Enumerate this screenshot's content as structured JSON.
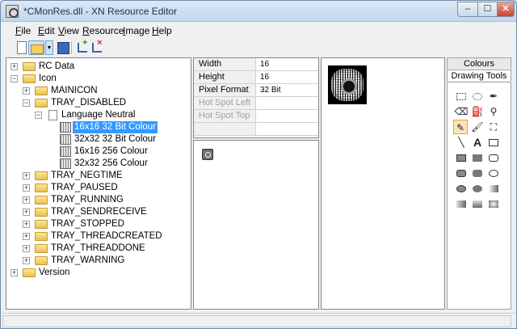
{
  "window": {
    "title": "*CMonRes.dll - XN Resource Editor",
    "minimize": "‒",
    "maximize": "☐",
    "close": "✕"
  },
  "menu": [
    "File",
    "Edit",
    "View",
    "Resource",
    "Image",
    "Help"
  ],
  "toolbar": {
    "buttons": [
      "new-icon",
      "open-icon",
      "save-icon",
      "add-resource-icon",
      "delete-resource-icon"
    ]
  },
  "tree": {
    "items": [
      {
        "label": "RC Data",
        "expander": "+"
      },
      {
        "label": "Icon",
        "expander": "−"
      },
      {
        "label": "MAINICON",
        "expander": "+"
      },
      {
        "label": "TRAY_DISABLED",
        "expander": "−"
      },
      {
        "label": "Language Neutral",
        "expander": "−"
      },
      {
        "label": "16x16 32 Bit Colour"
      },
      {
        "label": "32x32 32 Bit Colour"
      },
      {
        "label": "16x16 256 Colour"
      },
      {
        "label": "32x32 256 Colour"
      },
      {
        "label": "TRAY_NEGTIME",
        "expander": "+"
      },
      {
        "label": "TRAY_PAUSED",
        "expander": "+"
      },
      {
        "label": "TRAY_RUNNING",
        "expander": "+"
      },
      {
        "label": "TRAY_SENDRECEIVE",
        "expander": "+"
      },
      {
        "label": "TRAY_STOPPED",
        "expander": "+"
      },
      {
        "label": "TRAY_THREADCREATED",
        "expander": "+"
      },
      {
        "label": "TRAY_THREADDONE",
        "expander": "+"
      },
      {
        "label": "TRAY_WARNING",
        "expander": "+"
      },
      {
        "label": "Version",
        "expander": "+"
      }
    ]
  },
  "properties": [
    {
      "name": "Width",
      "value": "16"
    },
    {
      "name": "Height",
      "value": "16"
    },
    {
      "name": "Pixel Format",
      "value": "32 Bit"
    },
    {
      "name": "Hot Spot Left",
      "value": ""
    },
    {
      "name": "Hot Spot Top",
      "value": ""
    }
  ],
  "tools_panel": {
    "tab_colours": "Colours",
    "tab_drawing_tools": "Drawing Tools",
    "text_tool_glyph": "A",
    "tools": [
      "rectangle-select-icon",
      "lasso-select-icon",
      "eyedropper-icon",
      "eraser-icon",
      "fill-bucket-icon",
      "magnifier-icon",
      "pencil-icon",
      "brush-icon",
      "spray-icon",
      "line-icon",
      "text-icon",
      "rectangle-outline-icon",
      "rectangle-filled-icon",
      "rectangle-solid-icon",
      "rounded-rect-outline-icon",
      "rounded-rect-filled-icon",
      "rounded-rect-solid-icon",
      "ellipse-outline-icon",
      "ellipse-filled-icon",
      "ellipse-solid-icon",
      "gradient-icon",
      "gradient-horizontal-icon",
      "gradient-vertical-icon",
      "gradient-radial-icon"
    ]
  }
}
